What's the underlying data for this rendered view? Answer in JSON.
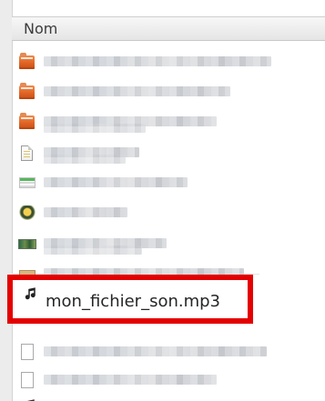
{
  "file_manager": {
    "column_header": {
      "label": "Nom"
    },
    "highlighted_file": {
      "name": "mon_fichier_son.mp3",
      "icon": "music-note-icon",
      "highlight_color": "#e40000"
    },
    "rows": [
      {
        "icon": "folder-icon"
      },
      {
        "icon": "folder-icon"
      },
      {
        "icon": "folder-icon"
      },
      {
        "icon": "document-icon"
      },
      {
        "icon": "text-file-icon"
      },
      {
        "icon": "image-file-icon"
      },
      {
        "icon": "image-file-icon"
      },
      {
        "icon": "archive-icon"
      },
      {
        "icon": "music-note-icon"
      },
      {
        "icon": "document-icon"
      },
      {
        "icon": "document-icon"
      },
      {
        "icon": "music-note-icon"
      }
    ]
  }
}
